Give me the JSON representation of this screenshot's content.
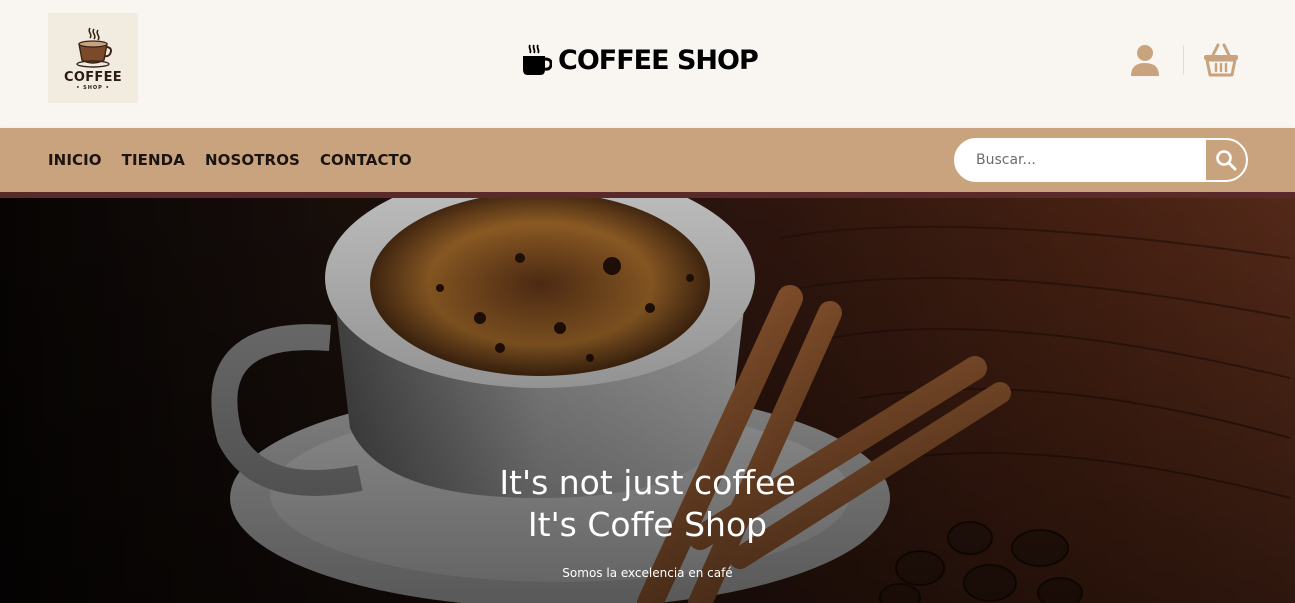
{
  "logo": {
    "title": "COFFEE",
    "subtitle": "• SHOP •"
  },
  "brand": {
    "title": "COFFEE SHOP"
  },
  "nav": {
    "items": [
      {
        "label": "INICIO"
      },
      {
        "label": "TIENDA"
      },
      {
        "label": "NOSOTROS"
      },
      {
        "label": "CONTACTO"
      }
    ]
  },
  "search": {
    "placeholder": "Buscar...",
    "value": ""
  },
  "hero": {
    "title_line1": "It's not just coffee",
    "title_line2": "It's Coffe Shop",
    "subtitle": "Somos la excelencia en café"
  },
  "icons": {
    "brand": "coffee-cup-icon",
    "user": "user-icon",
    "cart": "shopping-basket-icon",
    "search": "search-icon"
  },
  "colors": {
    "accent": "#c9a37e",
    "header_bg": "#f9f6f1",
    "nav_strip": "#5a2a2a",
    "text_dark": "#1b1410"
  }
}
